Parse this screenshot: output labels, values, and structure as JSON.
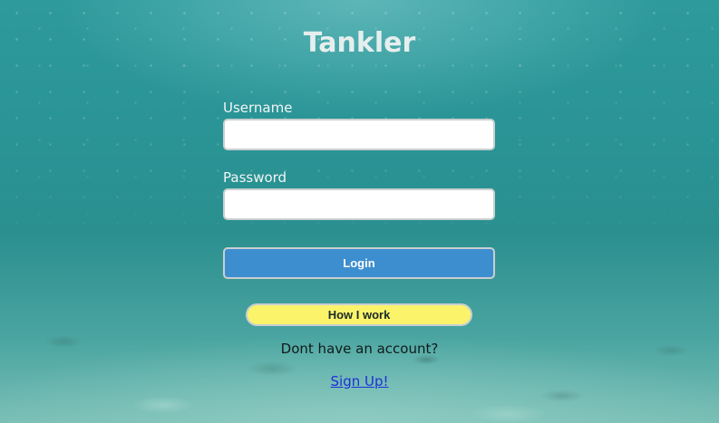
{
  "app": {
    "title": "Tankler"
  },
  "form": {
    "username_label": "Username",
    "username_value": "",
    "password_label": "Password",
    "password_value": "",
    "login_label": "Login"
  },
  "how_it_works": {
    "label": "How I work"
  },
  "signup": {
    "prompt": "Dont have an account?",
    "link_label": "Sign Up!"
  },
  "colors": {
    "login_button": "#3d8ecf",
    "how_button": "#fbf46b",
    "link": "#1f2fd6",
    "background": "#2b9394"
  }
}
